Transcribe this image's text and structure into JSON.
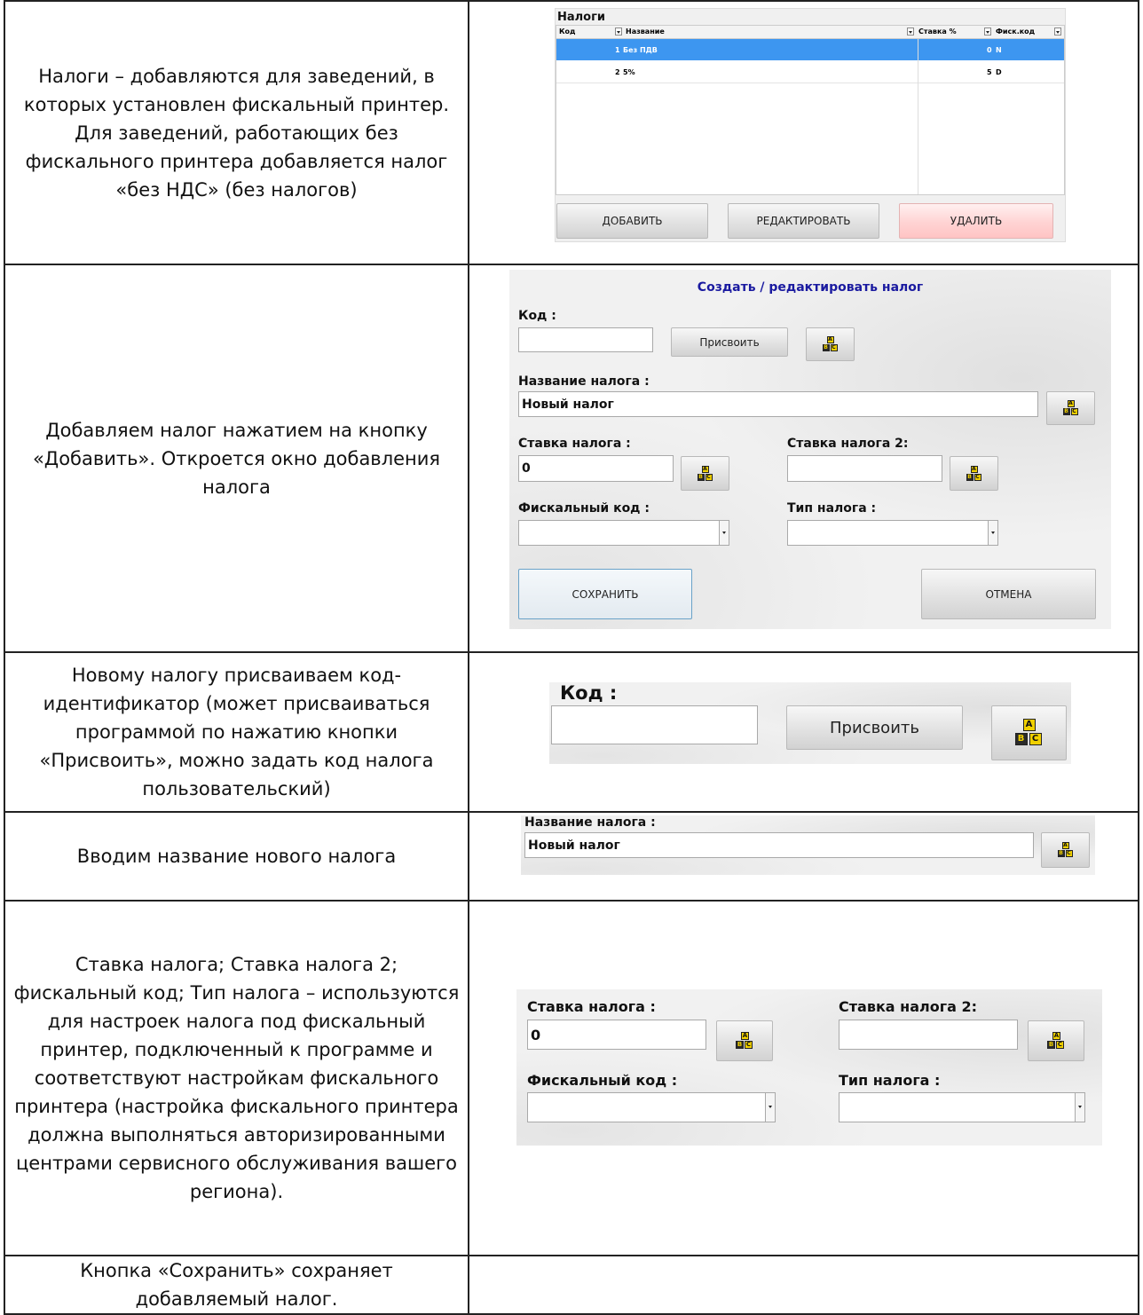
{
  "rows": [
    {
      "description": "Налоги – добавляются для заведений, в которых установлен фискальный принтер. Для заведений, работающих без фискального принтера добавляется налог «без НДС» (без налогов)"
    },
    {
      "description": "Добавляем налог нажатием на кнопку «Добавить». Откроется окно добавления налога"
    },
    {
      "description": "Новому налогу присваиваем код-идентификатор (может присваиваться программой по нажатию кнопки «Присвоить», можно задать код налога пользовательский)"
    },
    {
      "description": "Вводим название нового налога"
    },
    {
      "description": "Ставка налога; Ставка налога 2; фискальный код; Тип налога – используются для настроек налога под фискальный принтер, подключенный к программе и соответствуют настройкам фискального принтера (настройка фискального принтера должна выполняться авторизированными центрами сервисного обслуживания вашего региона)."
    },
    {
      "description": "Кнопка «Сохранить» сохраняет добавляемый налог."
    }
  ],
  "taxes_grid": {
    "title": "Налоги",
    "columns": [
      "Код",
      "Название",
      "Ставка %",
      "Фиск.код"
    ],
    "records": [
      {
        "code": "1",
        "name": "Без ПДВ",
        "rate": "0",
        "fiscal_code": "N"
      },
      {
        "code": "2",
        "name": "5%",
        "rate": "5",
        "fiscal_code": "D"
      }
    ],
    "buttons": {
      "add": "ДОБАВИТЬ",
      "edit": "РЕДАКТИРОВАТЬ",
      "delete": "УДАЛИТЬ"
    }
  },
  "tax_form": {
    "title": "Создать / редактировать налог",
    "code_label": "Код :",
    "code_value": "",
    "assign_button": "Присвоить",
    "name_label": "Название налога :",
    "name_value": "Новый налог",
    "rate_label": "Ставка налога :",
    "rate_value": "0",
    "rate2_label": "Ставка налога 2:",
    "rate2_value": "",
    "fiscal_code_label": "Фискальный код :",
    "fiscal_code_value": "",
    "tax_type_label": "Тип налога :",
    "tax_type_value": "",
    "save_button": "СОХРАНИТЬ",
    "cancel_button": "ОТМЕНА",
    "keyboard_icon_letters": [
      "A",
      "B",
      "C"
    ]
  },
  "colors": {
    "title_blue": "#1a1aa0",
    "selection_blue": "#3d96f0",
    "delete_red": "#ffd3d3",
    "keyboard_yellow": "#f0d000"
  }
}
